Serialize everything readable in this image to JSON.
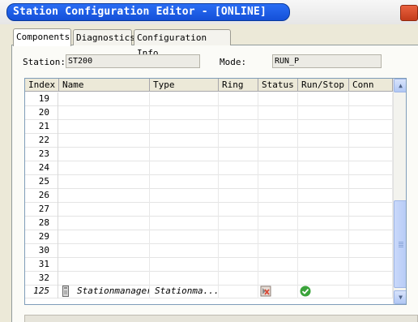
{
  "window": {
    "title": "Station Configuration Editor - [ONLINE]"
  },
  "tabs": [
    {
      "label": "Components",
      "active": true
    },
    {
      "label": "Diagnostics",
      "active": false
    },
    {
      "label": "Configuration Info",
      "active": false
    }
  ],
  "station": {
    "label": "Station:",
    "value": "ST200"
  },
  "mode": {
    "label": "Mode:",
    "value": "RUN_P"
  },
  "table": {
    "columns": [
      "Index",
      "Name",
      "Type",
      "Ring",
      "Status",
      "Run/Stop",
      "Conn"
    ],
    "empty_rows": [
      "19",
      "20",
      "21",
      "22",
      "23",
      "24",
      "25",
      "26",
      "27",
      "28",
      "29",
      "30",
      "31",
      "32"
    ],
    "station_row": {
      "index": "125",
      "name": "Stationmanager",
      "type": "Stationma...",
      "status_icon": "status-warning-icon",
      "runstop_icon": "check-circle-icon"
    }
  },
  "colors": {
    "title_bar": "#1450d8",
    "check": "#3aa33a"
  }
}
